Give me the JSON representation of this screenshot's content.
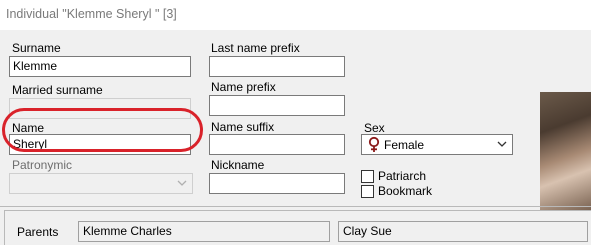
{
  "window": {
    "title": "Individual \"Klemme Sheryl \" [3]"
  },
  "form": {
    "surname_label": "Surname",
    "surname_value": "Klemme",
    "married_surname_label": "Married surname",
    "married_surname_value": "",
    "name_label": "Name",
    "name_value": "Sheryl",
    "patronymic_label": "Patronymic",
    "patronymic_value": "",
    "last_name_prefix_label": "Last name prefix",
    "last_name_prefix_value": "",
    "name_prefix_label": "Name prefix",
    "name_prefix_value": "",
    "name_suffix_label": "Name suffix",
    "name_suffix_value": "",
    "nickname_label": "Nickname",
    "nickname_value": "",
    "sex_label": "Sex",
    "sex_value": "Female",
    "patriarch_label": "Patriarch",
    "bookmark_label": "Bookmark"
  },
  "parents": {
    "label": "Parents",
    "father": "Klemme Charles",
    "mother": "Clay Sue"
  },
  "icons": {
    "sex": "female-symbol-icon",
    "dropdown": "chevron-down-icon"
  },
  "colors": {
    "highlight": "#d9222a",
    "female_icon": "#8b1a1a"
  }
}
